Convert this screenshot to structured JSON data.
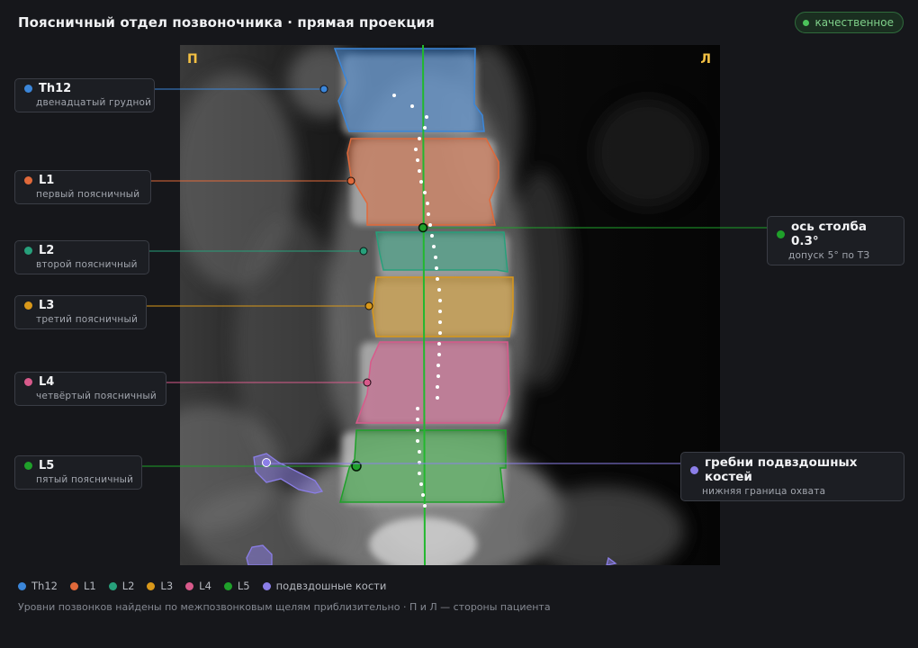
{
  "header": {
    "title": "Поясничный отдел позвоночника · прямая проекция",
    "badge": "качественное"
  },
  "viewer": {
    "right_side_mark": "П",
    "left_side_mark": "Л"
  },
  "vertebrae": [
    {
      "id": "th12",
      "name": "Th12",
      "desc": "двенадцатый грудной",
      "color": "#3b86d9"
    },
    {
      "id": "l1",
      "name": "L1",
      "desc": "первый поясничный",
      "color": "#e0693a"
    },
    {
      "id": "l2",
      "name": "L2",
      "desc": "второй поясничный",
      "color": "#27a07b"
    },
    {
      "id": "l3",
      "name": "L3",
      "desc": "третий поясничный",
      "color": "#d9981a"
    },
    {
      "id": "l4",
      "name": "L4",
      "desc": "четвёртый поясничный",
      "color": "#d85a8b"
    },
    {
      "id": "l5",
      "name": "L5",
      "desc": "пятый поясничный",
      "color": "#1fa02a"
    }
  ],
  "annotations": {
    "axis": {
      "name": "ось столба 0.3°",
      "desc": "допуск 5° по ТЗ",
      "color": "#1fa02a"
    },
    "iliac": {
      "name": "гребни подвздошных костей",
      "desc": "нижняя граница охвата",
      "color": "#8b7ee8"
    }
  },
  "legend": [
    {
      "label": "Th12",
      "color": "#3b86d9"
    },
    {
      "label": "L1",
      "color": "#e0693a"
    },
    {
      "label": "L2",
      "color": "#27a07b"
    },
    {
      "label": "L3",
      "color": "#d9981a"
    },
    {
      "label": "L4",
      "color": "#d85a8b"
    },
    {
      "label": "L5",
      "color": "#1fa02a"
    },
    {
      "label": "подвздошные кости",
      "color": "#8b7ee8"
    }
  ],
  "footnote": "Уровни позвонков найдены по межпозвонковым щелям приблизительно · П и Л — стороны пациента"
}
